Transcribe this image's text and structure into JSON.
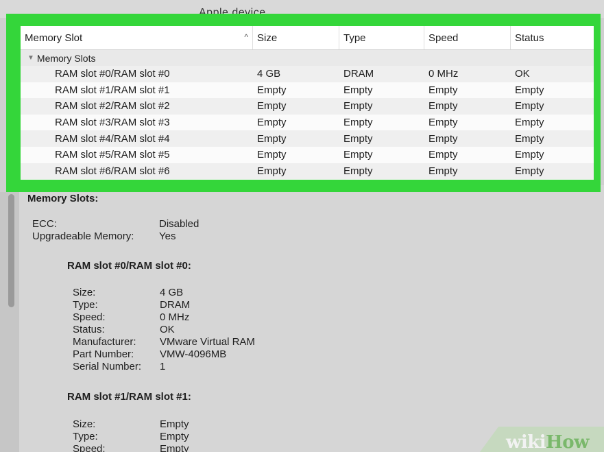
{
  "window": {
    "top_clipped_title": "Apple device"
  },
  "table": {
    "columns": [
      "Memory Slot",
      "Size",
      "Type",
      "Speed",
      "Status"
    ],
    "sort_indicator": "^",
    "group_label": "Memory Slots",
    "rows": [
      [
        "RAM slot #0/RAM slot #0",
        "4 GB",
        "DRAM",
        "0 MHz",
        "OK"
      ],
      [
        "RAM slot #1/RAM slot #1",
        "Empty",
        "Empty",
        "Empty",
        "Empty"
      ],
      [
        "RAM slot #2/RAM slot #2",
        "Empty",
        "Empty",
        "Empty",
        "Empty"
      ],
      [
        "RAM slot #3/RAM slot #3",
        "Empty",
        "Empty",
        "Empty",
        "Empty"
      ],
      [
        "RAM slot #4/RAM slot #4",
        "Empty",
        "Empty",
        "Empty",
        "Empty"
      ],
      [
        "RAM slot #5/RAM slot #5",
        "Empty",
        "Empty",
        "Empty",
        "Empty"
      ],
      [
        "RAM slot #6/RAM slot #6",
        "Empty",
        "Empty",
        "Empty",
        "Empty"
      ]
    ]
  },
  "details": {
    "section_title": "Memory Slots:",
    "ecc_label": "ECC:",
    "ecc_value": "Disabled",
    "upgradeable_label": "Upgradeable Memory:",
    "upgradeable_value": "Yes",
    "slot0_title": "RAM slot #0/RAM slot #0:",
    "slot0": {
      "size_label": "Size:",
      "size_value": "4 GB",
      "type_label": "Type:",
      "type_value": "DRAM",
      "speed_label": "Speed:",
      "speed_value": "0 MHz",
      "status_label": "Status:",
      "status_value": "OK",
      "manufacturer_label": "Manufacturer:",
      "manufacturer_value": "VMware Virtual RAM",
      "part_label": "Part Number:",
      "part_value": "VMW-4096MB",
      "serial_label": "Serial Number:",
      "serial_value": "1"
    },
    "slot1_title": "RAM slot #1/RAM slot #1:",
    "slot1": {
      "size_label": "Size:",
      "size_value": "Empty",
      "type_label": "Type:",
      "type_value": "Empty",
      "speed_label": "Speed:",
      "speed_value": "Empty"
    }
  },
  "watermark": {
    "wiki": "wiki",
    "how": "How"
  },
  "colors": {
    "highlight_frame": "#34d63a",
    "window_bg": "#d6d6d6"
  }
}
